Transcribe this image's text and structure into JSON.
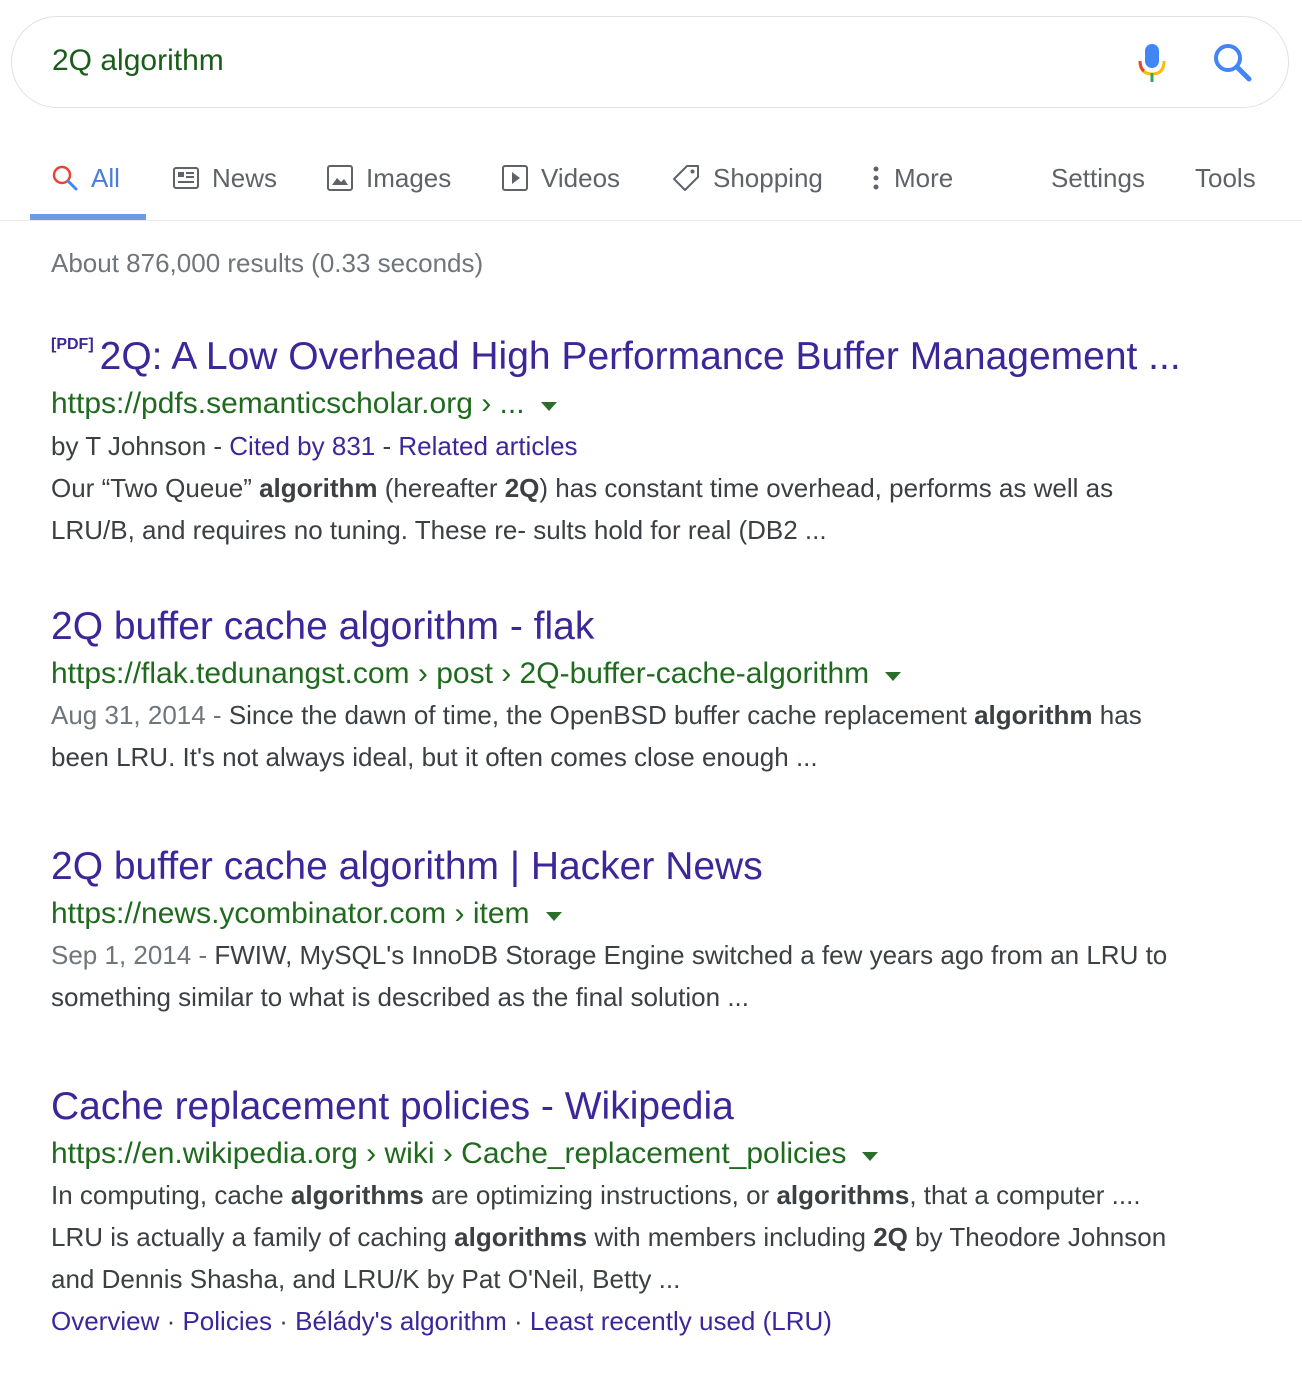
{
  "search": {
    "query": "2Q algorithm"
  },
  "icons": {
    "mic": "microphone-icon",
    "search": "search-icon"
  },
  "colors": {
    "title_link": "#3d2699",
    "url_green": "#1e6b1e",
    "active_tab": "#4a7dd6"
  },
  "tabs": [
    {
      "label": "All",
      "icon": "search-icon",
      "active": true
    },
    {
      "label": "News",
      "icon": "news-icon"
    },
    {
      "label": "Images",
      "icon": "image-icon"
    },
    {
      "label": "Videos",
      "icon": "video-icon"
    },
    {
      "label": "Shopping",
      "icon": "tag-icon"
    },
    {
      "label": "More",
      "icon": "more-vert-icon"
    },
    {
      "label": "Settings"
    },
    {
      "label": "Tools"
    }
  ],
  "stats": "About 876,000 results (0.33 seconds)",
  "results": [
    {
      "badge": "[PDF]",
      "title": "2Q: A Low Overhead High Performance Buffer Management ...",
      "url": "https://pdfs.semanticscholar.org › ...",
      "meta": {
        "author": "by T Johnson - ",
        "cited": "Cited by 831",
        "sep": " - ",
        "related": "Related articles"
      },
      "snippet": [
        [
          {
            "t": "Our “Two Queue” "
          },
          {
            "t": "algorithm",
            "b": true
          },
          {
            "t": " (hereafter "
          },
          {
            "t": "2Q",
            "b": true
          },
          {
            "t": ") has constant time overhead, performs as well as"
          }
        ],
        [
          {
            "t": "LRU/B, and requires no tuning. These re- sults hold for real (DB2 ..."
          }
        ]
      ]
    },
    {
      "title": "2Q buffer cache algorithm - flak",
      "url": "https://flak.tedunangst.com › post › 2Q-buffer-cache-algorithm",
      "snippet": [
        [
          {
            "t": "Aug 31, 2014 - ",
            "d": true
          },
          {
            "t": "Since the dawn of time, the OpenBSD buffer cache replacement "
          },
          {
            "t": "algorithm",
            "b": true
          },
          {
            "t": " has"
          }
        ],
        [
          {
            "t": "been LRU. It's not always ideal, but it often comes close enough ..."
          }
        ]
      ]
    },
    {
      "title": "2Q buffer cache algorithm | Hacker News",
      "url": "https://news.ycombinator.com › item",
      "snippet": [
        [
          {
            "t": "Sep 1, 2014 - ",
            "d": true
          },
          {
            "t": "FWIW, MySQL's InnoDB Storage Engine switched a few years ago from an LRU to"
          }
        ],
        [
          {
            "t": "something similar to what is described as the final solution ..."
          }
        ]
      ]
    },
    {
      "title": "Cache replacement policies - Wikipedia",
      "url": "https://en.wikipedia.org › wiki › Cache_replacement_policies",
      "snippet": [
        [
          {
            "t": "In computing, cache "
          },
          {
            "t": "algorithms",
            "b": true
          },
          {
            "t": " are optimizing instructions, or "
          },
          {
            "t": "algorithms",
            "b": true
          },
          {
            "t": ", that a computer ...."
          }
        ],
        [
          {
            "t": "LRU is actually a family of caching "
          },
          {
            "t": "algorithms",
            "b": true
          },
          {
            "t": " with members including "
          },
          {
            "t": "2Q",
            "b": true
          },
          {
            "t": " by Theodore Johnson"
          }
        ],
        [
          {
            "t": "and Dennis Shasha, and LRU/K by Pat O'Neil, Betty ..."
          }
        ]
      ],
      "sitelinks": [
        "Overview",
        "Policies",
        "Bélády's algorithm",
        "Least recently used (LRU)"
      ]
    }
  ]
}
